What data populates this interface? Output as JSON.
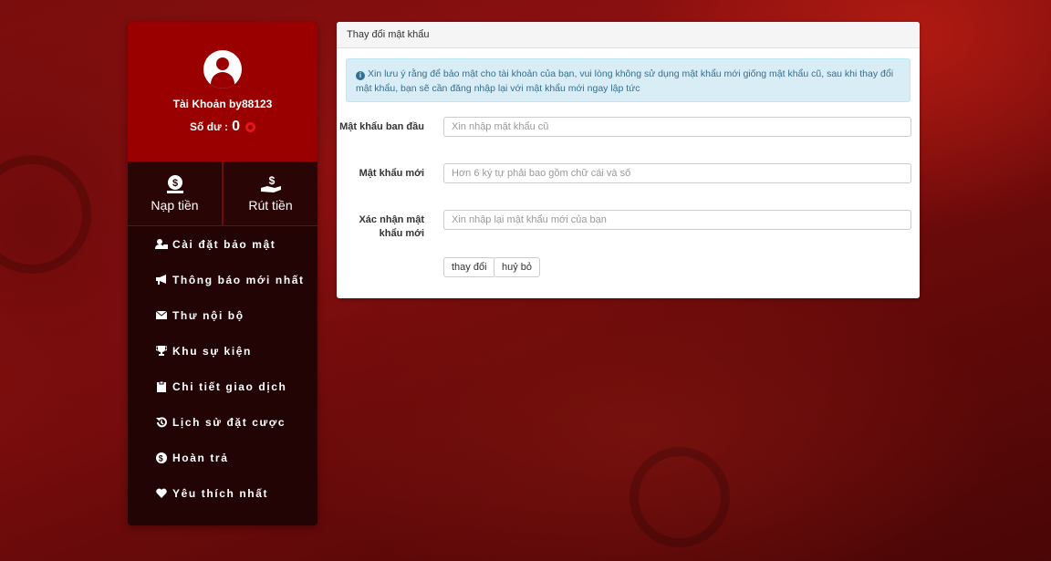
{
  "profile": {
    "account_label": "Tài Khoản by88123",
    "balance_label": "Số dư :",
    "balance_value": "0"
  },
  "actions": {
    "deposit_label": "Nạp tiền",
    "withdraw_label": "Rút tiền"
  },
  "menu": {
    "items": [
      {
        "label": "Cài đặt bảo mật",
        "icon": "user-lock-icon"
      },
      {
        "label": "Thông báo mới nhất",
        "icon": "megaphone-icon"
      },
      {
        "label": "Thư nội bộ",
        "icon": "envelope-icon"
      },
      {
        "label": "Khu sự kiện",
        "icon": "trophy-icon"
      },
      {
        "label": "Chi tiết giao dịch",
        "icon": "clipboard-icon"
      },
      {
        "label": "Lịch sử đặt cược",
        "icon": "history-icon"
      },
      {
        "label": "Hoàn trả",
        "icon": "dollar-coin-icon"
      },
      {
        "label": "Yêu thích nhất",
        "icon": "heart-icon"
      }
    ]
  },
  "panel": {
    "title": "Thay đổi mật khẩu",
    "notice": "Xin lưu ý rằng để bảo mật cho tài khoản của bạn, vui lòng không sử dụng mật khẩu mới giống mật khẩu cũ, sau khi thay đổi mật khẩu, bạn sẽ cần đăng nhập lại với mật khẩu mới ngay lập tức",
    "fields": {
      "old_password": {
        "label": "Mật khẩu ban đầu",
        "placeholder": "Xin nhập mật khẩu cũ"
      },
      "new_password": {
        "label": "Mật khẩu mới",
        "placeholder": "Hơn 6 ký tự phải bao gồm chữ cái và số"
      },
      "confirm_password": {
        "label_line1": "Xác nhận mật",
        "label_line2": "khẩu mới",
        "placeholder": "Xin nhập lại mật khẩu mới của bạn"
      }
    },
    "submit_label": "thay đổi",
    "cancel_label": "huỷ bỏ"
  },
  "colors": {
    "profile_bg": "#9b0000",
    "sidebar_bg": "#220404",
    "alert_bg": "#d9edf7",
    "alert_text": "#31708f"
  }
}
